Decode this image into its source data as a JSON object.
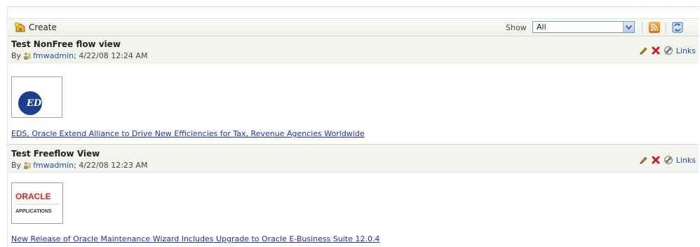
{
  "toolbar": {
    "create_label": "Create",
    "show_label": "Show",
    "show_value": "All",
    "icons": [
      "create-icon",
      "rss-feed-icon",
      "refresh-icon"
    ]
  },
  "items": [
    {
      "title": "Test NonFree flow view",
      "by_prefix": "By",
      "author": "fmwadmin",
      "date": "; 4/22/08 12:24 AM",
      "links_label": "Links",
      "thumbnail_text": "EDS",
      "article": "EDS, Oracle Extend Alliance to Drive New Efficiencies for Tax, Revenue Agencies Worldwide"
    },
    {
      "title": "Test Freeflow View",
      "by_prefix": "By",
      "author": "fmwadmin",
      "date": "; 4/22/08 12:23 AM",
      "links_label": "Links",
      "thumbnail_text": "ORACLE",
      "thumbnail_subtext": "APPLICATIONS",
      "article": "New Release of Oracle Maintenance Wizard Includes Upgrade to Oracle E-Business Suite 12.0.4"
    }
  ],
  "colors": {
    "link": "#1f2fb8",
    "header_bg": "#f2f4ee",
    "oracle_red": "#e2231a",
    "eds_blue": "#1a3f8f"
  }
}
